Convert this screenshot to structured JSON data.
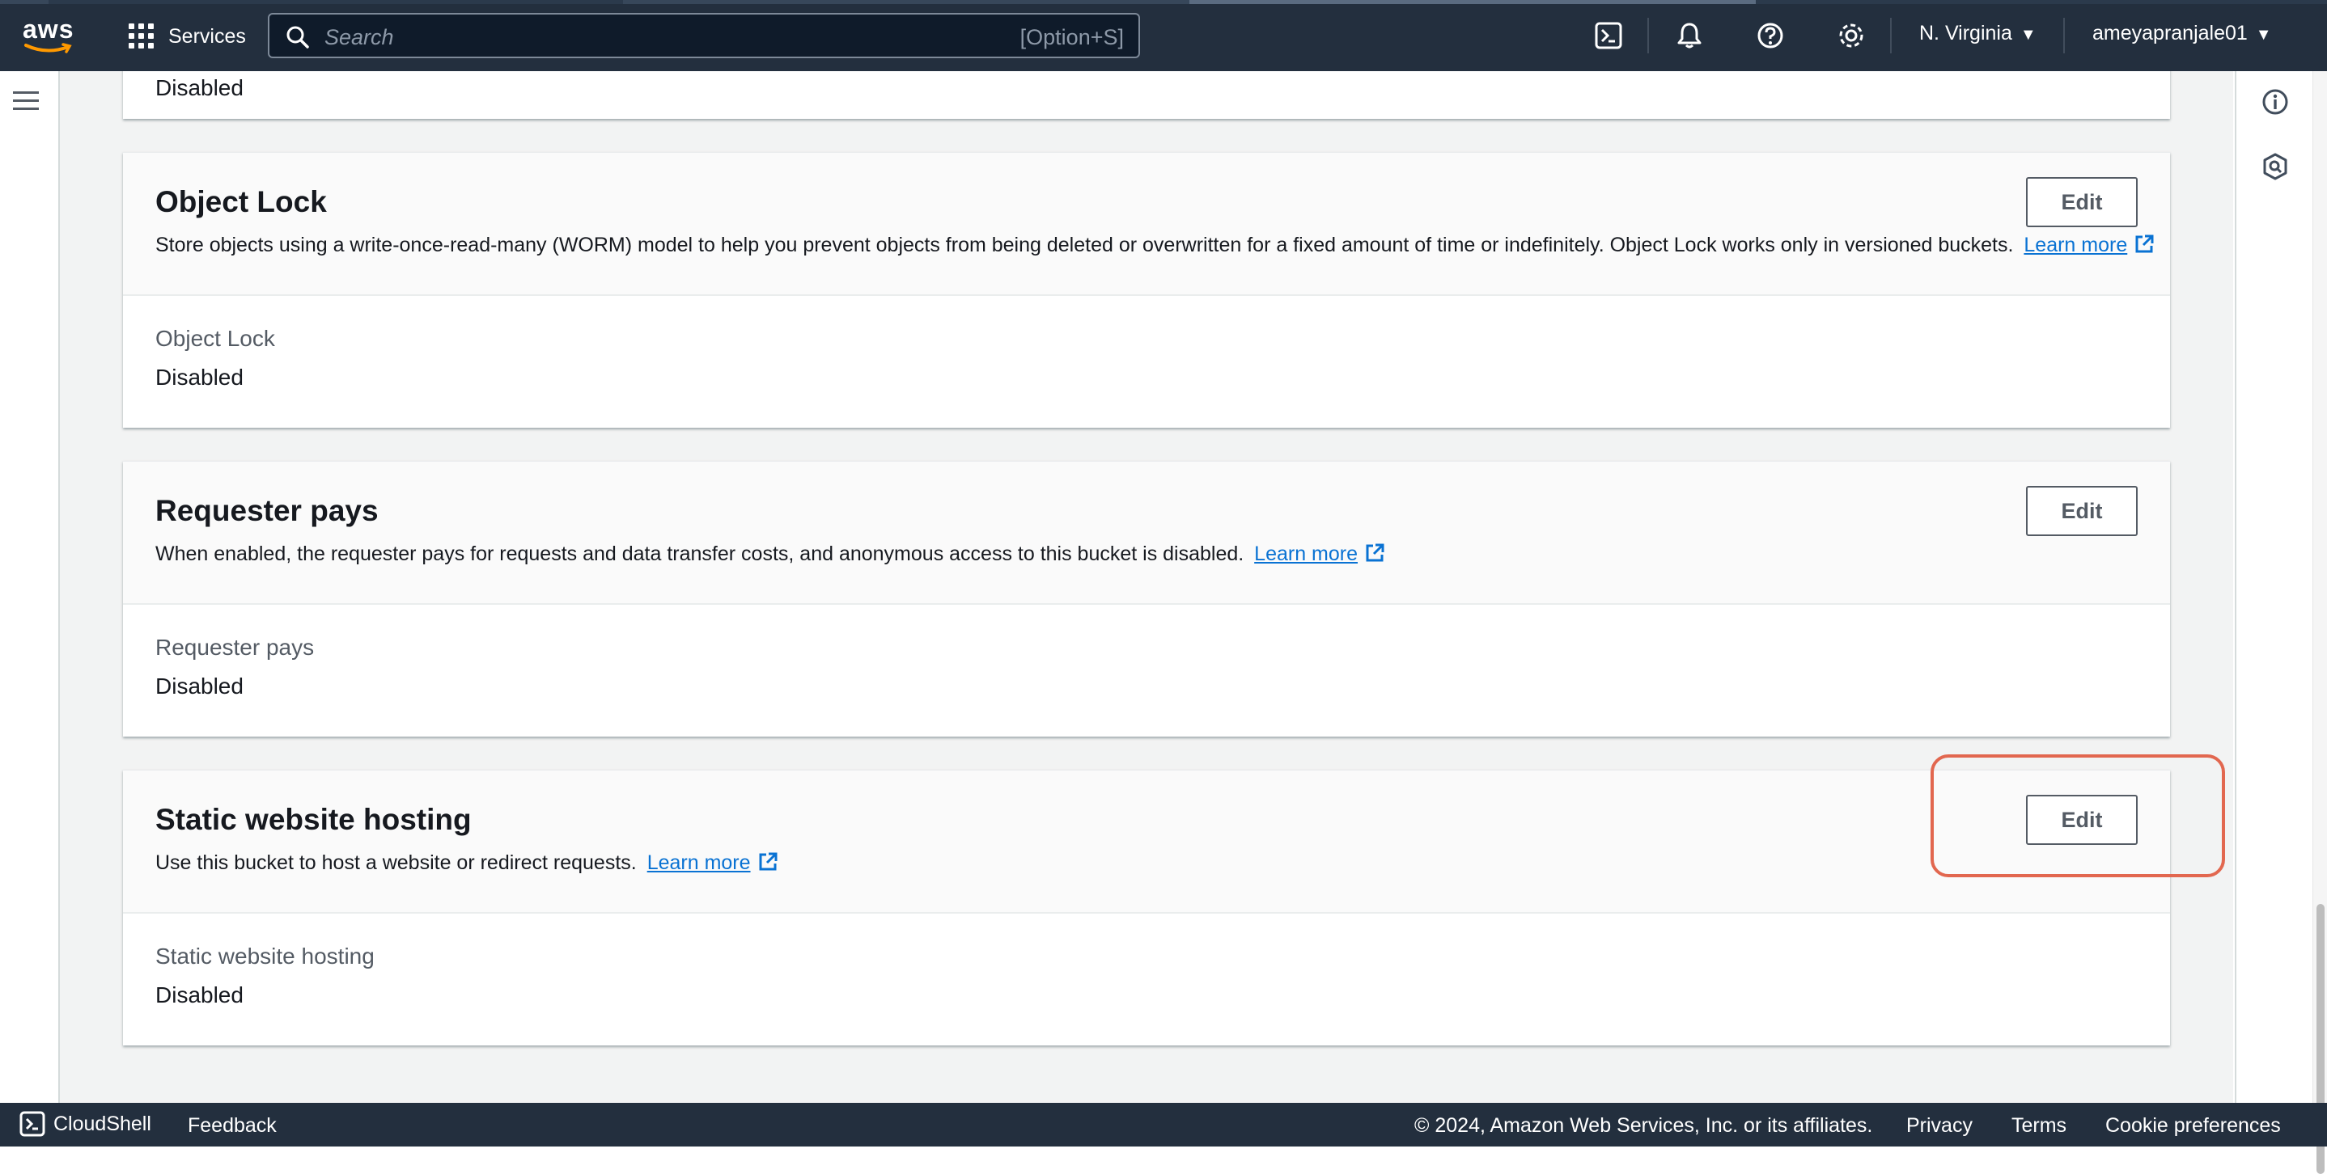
{
  "topnav": {
    "logo_text": "aws",
    "services_label": "Services",
    "search_placeholder": "Search",
    "search_shortcut": "[Option+S]",
    "region": "N. Virginia",
    "user": "ameyapranjale01",
    "icons": [
      "cloudshell-icon",
      "bell-icon",
      "help-icon",
      "gear-icon"
    ]
  },
  "prev_panel": {
    "value": "Disabled"
  },
  "panels": [
    {
      "title": "Object Lock",
      "description": "Store objects using a write-once-read-many (WORM) model to help you prevent objects from being deleted or overwritten for a fixed amount of time or indefinitely. Object Lock works only in versioned buckets.",
      "link": "Learn more",
      "edit": "Edit",
      "prop_label": "Object Lock",
      "prop_value": "Disabled"
    },
    {
      "title": "Requester pays",
      "description": "When enabled, the requester pays for requests and data transfer costs, and anonymous access to this bucket is disabled.",
      "link": "Learn more",
      "edit": "Edit",
      "prop_label": "Requester pays",
      "prop_value": "Disabled"
    },
    {
      "title": "Static website hosting",
      "description": "Use this bucket to host a website or redirect requests.",
      "link": "Learn more",
      "edit": "Edit",
      "prop_label": "Static website hosting",
      "prop_value": "Disabled"
    }
  ],
  "footer": {
    "cloudshell": "CloudShell",
    "feedback": "Feedback",
    "copyright": "© 2024, Amazon Web Services, Inc. or its affiliates.",
    "privacy": "Privacy",
    "terms": "Terms",
    "cookies": "Cookie preferences"
  },
  "colors": {
    "nav_bg": "#232f3e",
    "link": "#0972d3",
    "highlight": "#e2674f"
  }
}
